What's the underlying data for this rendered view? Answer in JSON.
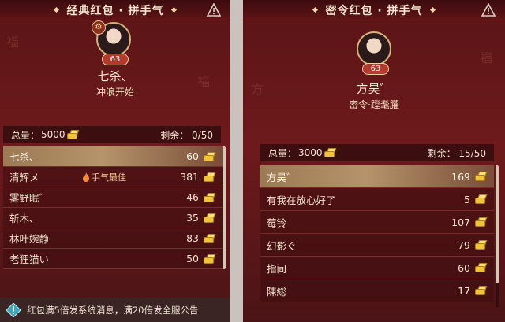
{
  "left_panel": {
    "title": "经典红包 · 拼手气",
    "level": "63",
    "deco_badge": "⚙",
    "name": "七杀、",
    "subtitle": "冲浪开始",
    "total_label": "总量：",
    "total_value": "5000",
    "remaining": "剩余：  0/50",
    "rows": [
      {
        "name": "七杀、",
        "amount": "60",
        "best": ""
      },
      {
        "name": "清辉メ",
        "amount": "381",
        "best": "手气最佳"
      },
      {
        "name": "雾野眠゛",
        "amount": "46",
        "best": ""
      },
      {
        "name": "斩木、",
        "amount": "35",
        "best": ""
      },
      {
        "name": "林叶婉静",
        "amount": "83",
        "best": ""
      },
      {
        "name": "老狸猫い",
        "amount": "50",
        "best": ""
      }
    ],
    "footer": "红包满5倍发系统消息，满20倍发全服公告"
  },
  "right_panel": {
    "title": "密令红包 · 拼手气",
    "level": "63",
    "name": "方昊゛",
    "subtitle": "密令·蹚耄臞",
    "total_label": "总量：",
    "total_value": "3000",
    "remaining": "剩余：  15/50",
    "rows": [
      {
        "name": "方昊゛",
        "amount": "169"
      },
      {
        "name": "有我在放心好了",
        "amount": "5"
      },
      {
        "name": "莓铃",
        "amount": "107"
      },
      {
        "name": "幻影ぐ",
        "amount": "79"
      },
      {
        "name": "指间",
        "amount": "60"
      },
      {
        "name": "陳総",
        "amount": "17"
      }
    ]
  },
  "colors": {
    "accent_gold": "#f0c43a",
    "panel_red": "#6e1a1c",
    "highlight_row": "#b5946a"
  },
  "icons": [
    "warning-icon",
    "coin-icon",
    "flame-icon",
    "info-icon",
    "avatar"
  ]
}
